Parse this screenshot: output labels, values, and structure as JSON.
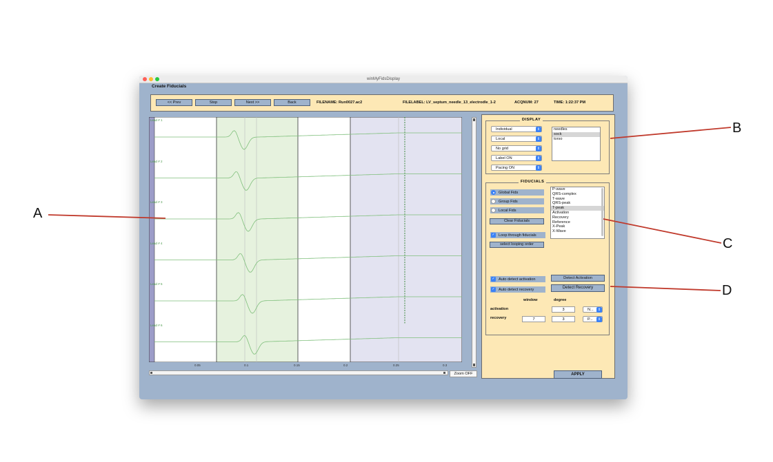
{
  "window": {
    "title": "winMyFidsDisplay",
    "figure_title": "Create Fiducials"
  },
  "toolbar": {
    "prev_label": "<< Prev",
    "stop_label": "Stop",
    "next_label": "Next >>",
    "back_label": "Back",
    "filename": "FILENAME: Run0027.ac2",
    "filelabel": "FILELABEL: LV_septum_needle_13_electrodle_1-2",
    "acqnum": "ACQNUM: 27",
    "time": "TIME: 1:22:37 PM"
  },
  "plot": {
    "channel_labels": [
      "Lead # 1",
      "Lead # 2",
      "Lead # 3",
      "Lead # 4",
      "Lead # 5",
      "Lead # 6"
    ],
    "x_ticks": [
      "0.05",
      "0.1",
      "0.15",
      "0.2",
      "0.25",
      "0.3"
    ],
    "zoom_label": "Zoom OFF",
    "colors": {
      "trace": "#7fbf7b",
      "window_green": "#e6f2de",
      "window_purple": "#e3e3f1",
      "marker": "#3e8a3e"
    }
  },
  "display": {
    "title": "DISPLAY",
    "popups": [
      "Individual",
      "Local",
      "No grid",
      "Label ON",
      "Pacing ON"
    ],
    "list": [
      "needles",
      "sock",
      "torso"
    ],
    "selected": "sock"
  },
  "fiducials": {
    "title": "FIDUCIALS",
    "radios": [
      {
        "label": "Global Fids",
        "selected": true
      },
      {
        "label": "Group Fids",
        "selected": false
      },
      {
        "label": "Local Fids",
        "selected": false
      }
    ],
    "clear_label": "Clear Fiducials",
    "loop_label": "Loop through fiducials",
    "order_label": "select looping order",
    "list": [
      "P-wave",
      "QRS-complex",
      "T-wave",
      "QRS-peak",
      "T-peak",
      "Activation",
      "Recovery",
      "Reference",
      "X-Peak",
      "X-Wave"
    ],
    "selected": "T-peak"
  },
  "detection": {
    "auto_activation_label": "Auto detect activation",
    "auto_recovery_label": "Auto detect recovery",
    "detect_activation_label": "Detect Activation",
    "detect_recovery_label": "Detect Recovery",
    "window_header": "window",
    "degree_header": "degree",
    "activation_label": "activation",
    "recovery_label": "recovery",
    "activation_degree": "3",
    "activation_method": "N...",
    "recovery_window": "7",
    "recovery_degree": "3",
    "recovery_method": "P..."
  },
  "apply_label": "APPLY",
  "callouts": {
    "a": "A",
    "b": "B",
    "c": "C",
    "d": "D",
    "color": "#c0392b"
  }
}
